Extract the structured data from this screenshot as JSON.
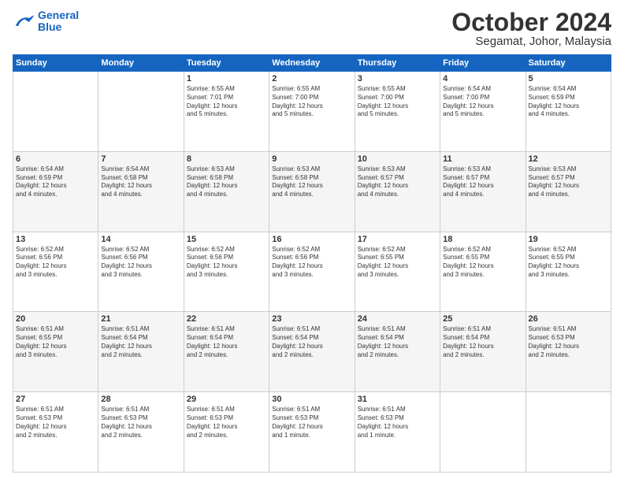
{
  "logo": {
    "line1": "General",
    "line2": "Blue"
  },
  "header": {
    "title": "October 2024",
    "subtitle": "Segamat, Johor, Malaysia"
  },
  "days_of_week": [
    "Sunday",
    "Monday",
    "Tuesday",
    "Wednesday",
    "Thursday",
    "Friday",
    "Saturday"
  ],
  "weeks": [
    [
      {
        "day": "",
        "info": ""
      },
      {
        "day": "",
        "info": ""
      },
      {
        "day": "1",
        "info": "Sunrise: 6:55 AM\nSunset: 7:01 PM\nDaylight: 12 hours\nand 5 minutes."
      },
      {
        "day": "2",
        "info": "Sunrise: 6:55 AM\nSunset: 7:00 PM\nDaylight: 12 hours\nand 5 minutes."
      },
      {
        "day": "3",
        "info": "Sunrise: 6:55 AM\nSunset: 7:00 PM\nDaylight: 12 hours\nand 5 minutes."
      },
      {
        "day": "4",
        "info": "Sunrise: 6:54 AM\nSunset: 7:00 PM\nDaylight: 12 hours\nand 5 minutes."
      },
      {
        "day": "5",
        "info": "Sunrise: 6:54 AM\nSunset: 6:59 PM\nDaylight: 12 hours\nand 4 minutes."
      }
    ],
    [
      {
        "day": "6",
        "info": "Sunrise: 6:54 AM\nSunset: 6:59 PM\nDaylight: 12 hours\nand 4 minutes."
      },
      {
        "day": "7",
        "info": "Sunrise: 6:54 AM\nSunset: 6:58 PM\nDaylight: 12 hours\nand 4 minutes."
      },
      {
        "day": "8",
        "info": "Sunrise: 6:53 AM\nSunset: 6:58 PM\nDaylight: 12 hours\nand 4 minutes."
      },
      {
        "day": "9",
        "info": "Sunrise: 6:53 AM\nSunset: 6:58 PM\nDaylight: 12 hours\nand 4 minutes."
      },
      {
        "day": "10",
        "info": "Sunrise: 6:53 AM\nSunset: 6:57 PM\nDaylight: 12 hours\nand 4 minutes."
      },
      {
        "day": "11",
        "info": "Sunrise: 6:53 AM\nSunset: 6:57 PM\nDaylight: 12 hours\nand 4 minutes."
      },
      {
        "day": "12",
        "info": "Sunrise: 6:53 AM\nSunset: 6:57 PM\nDaylight: 12 hours\nand 4 minutes."
      }
    ],
    [
      {
        "day": "13",
        "info": "Sunrise: 6:52 AM\nSunset: 6:56 PM\nDaylight: 12 hours\nand 3 minutes."
      },
      {
        "day": "14",
        "info": "Sunrise: 6:52 AM\nSunset: 6:56 PM\nDaylight: 12 hours\nand 3 minutes."
      },
      {
        "day": "15",
        "info": "Sunrise: 6:52 AM\nSunset: 6:56 PM\nDaylight: 12 hours\nand 3 minutes."
      },
      {
        "day": "16",
        "info": "Sunrise: 6:52 AM\nSunset: 6:56 PM\nDaylight: 12 hours\nand 3 minutes."
      },
      {
        "day": "17",
        "info": "Sunrise: 6:52 AM\nSunset: 6:55 PM\nDaylight: 12 hours\nand 3 minutes."
      },
      {
        "day": "18",
        "info": "Sunrise: 6:52 AM\nSunset: 6:55 PM\nDaylight: 12 hours\nand 3 minutes."
      },
      {
        "day": "19",
        "info": "Sunrise: 6:52 AM\nSunset: 6:55 PM\nDaylight: 12 hours\nand 3 minutes."
      }
    ],
    [
      {
        "day": "20",
        "info": "Sunrise: 6:51 AM\nSunset: 6:55 PM\nDaylight: 12 hours\nand 3 minutes."
      },
      {
        "day": "21",
        "info": "Sunrise: 6:51 AM\nSunset: 6:54 PM\nDaylight: 12 hours\nand 2 minutes."
      },
      {
        "day": "22",
        "info": "Sunrise: 6:51 AM\nSunset: 6:54 PM\nDaylight: 12 hours\nand 2 minutes."
      },
      {
        "day": "23",
        "info": "Sunrise: 6:51 AM\nSunset: 6:54 PM\nDaylight: 12 hours\nand 2 minutes."
      },
      {
        "day": "24",
        "info": "Sunrise: 6:51 AM\nSunset: 6:54 PM\nDaylight: 12 hours\nand 2 minutes."
      },
      {
        "day": "25",
        "info": "Sunrise: 6:51 AM\nSunset: 6:54 PM\nDaylight: 12 hours\nand 2 minutes."
      },
      {
        "day": "26",
        "info": "Sunrise: 6:51 AM\nSunset: 6:53 PM\nDaylight: 12 hours\nand 2 minutes."
      }
    ],
    [
      {
        "day": "27",
        "info": "Sunrise: 6:51 AM\nSunset: 6:53 PM\nDaylight: 12 hours\nand 2 minutes."
      },
      {
        "day": "28",
        "info": "Sunrise: 6:51 AM\nSunset: 6:53 PM\nDaylight: 12 hours\nand 2 minutes."
      },
      {
        "day": "29",
        "info": "Sunrise: 6:51 AM\nSunset: 6:53 PM\nDaylight: 12 hours\nand 2 minutes."
      },
      {
        "day": "30",
        "info": "Sunrise: 6:51 AM\nSunset: 6:53 PM\nDaylight: 12 hours\nand 1 minute."
      },
      {
        "day": "31",
        "info": "Sunrise: 6:51 AM\nSunset: 6:53 PM\nDaylight: 12 hours\nand 1 minute."
      },
      {
        "day": "",
        "info": ""
      },
      {
        "day": "",
        "info": ""
      }
    ]
  ]
}
